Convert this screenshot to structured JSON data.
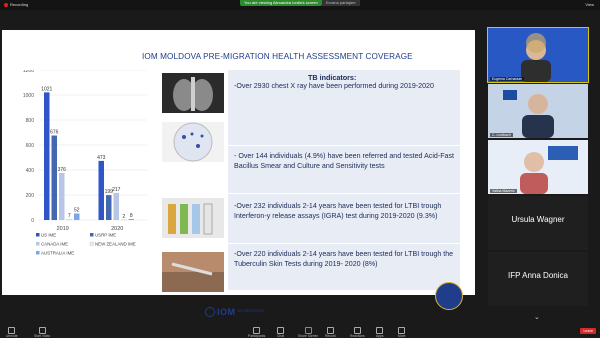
{
  "window": {
    "recording_label": "Recording",
    "speaking_label": "You are viewing Alexandra Ionita's screen",
    "sharing_label": "Ecrana partajare",
    "view_label": "View"
  },
  "slide": {
    "title": "IOM MOLDOVA PRE-MIGRATION HEALTH ASSESSMENT COVERAGE",
    "indicators_heading": "TB indicators:",
    "indicators": [
      "-Over 2930 chest X ray have been performed  during 2019-2020",
      "- Over 144 individuals (4.9%) have been referred and tested Acid-Fast Bacillus Smear and Culture and Sensitivity tests",
      "-Over 232 individuals 2-14 years have been tested for  LTBI trough Interferon-y release assays (IGRA) test during 2019-2020 (9.3%)",
      "-Over 220 individuals 2-14 years have been tested for LTBI trough the Tuberculin Skin Tests  during 2019- 2020 (8%)"
    ],
    "logo_text": "IOM",
    "logo_sub": "UN MIGRATION"
  },
  "chart_data": {
    "type": "bar",
    "categories": [
      "2019",
      "2020"
    ],
    "series": [
      {
        "name": "US IME",
        "values": [
          1021,
          473
        ],
        "color": "#2f55c8"
      },
      {
        "name": "USRP IME",
        "values": [
          676,
          199
        ],
        "color": "#4468b0"
      },
      {
        "name": "CANADA IME",
        "values": [
          376,
          217
        ],
        "color": "#b7c5e6"
      },
      {
        "name": "NEW ZEALAND IME",
        "values": [
          7,
          2
        ],
        "color": "#e6ebf5"
      },
      {
        "name": "AUSTRALIA IME",
        "values": [
          52,
          8
        ],
        "color": "#7da4e8"
      }
    ],
    "data_labels": [
      [
        "1021",
        "676",
        "376",
        "7",
        "52"
      ],
      [
        "473",
        "199",
        "217",
        "2",
        "8"
      ]
    ],
    "ylim": [
      0,
      1200
    ],
    "yticks": [
      "0",
      "200",
      "400",
      "600",
      "800",
      "1000",
      "1200"
    ],
    "grid": true,
    "legend": "bottom"
  },
  "participants": [
    {
      "name": "Eugenia Carhaidari",
      "type": "video"
    },
    {
      "name": "C. Lindbach",
      "type": "video"
    },
    {
      "name": "Valina Mazeric",
      "type": "video"
    },
    {
      "name": "Ursula Wagner",
      "type": "name"
    },
    {
      "name": "IFP Anna Donica",
      "type": "name"
    }
  ],
  "toolbar": {
    "items": [
      "Unmute",
      "Start Video",
      "Participants",
      "Chat",
      "Share Screen",
      "Record",
      "Reactions",
      "Apps",
      "More"
    ],
    "end_label": "Leave"
  }
}
